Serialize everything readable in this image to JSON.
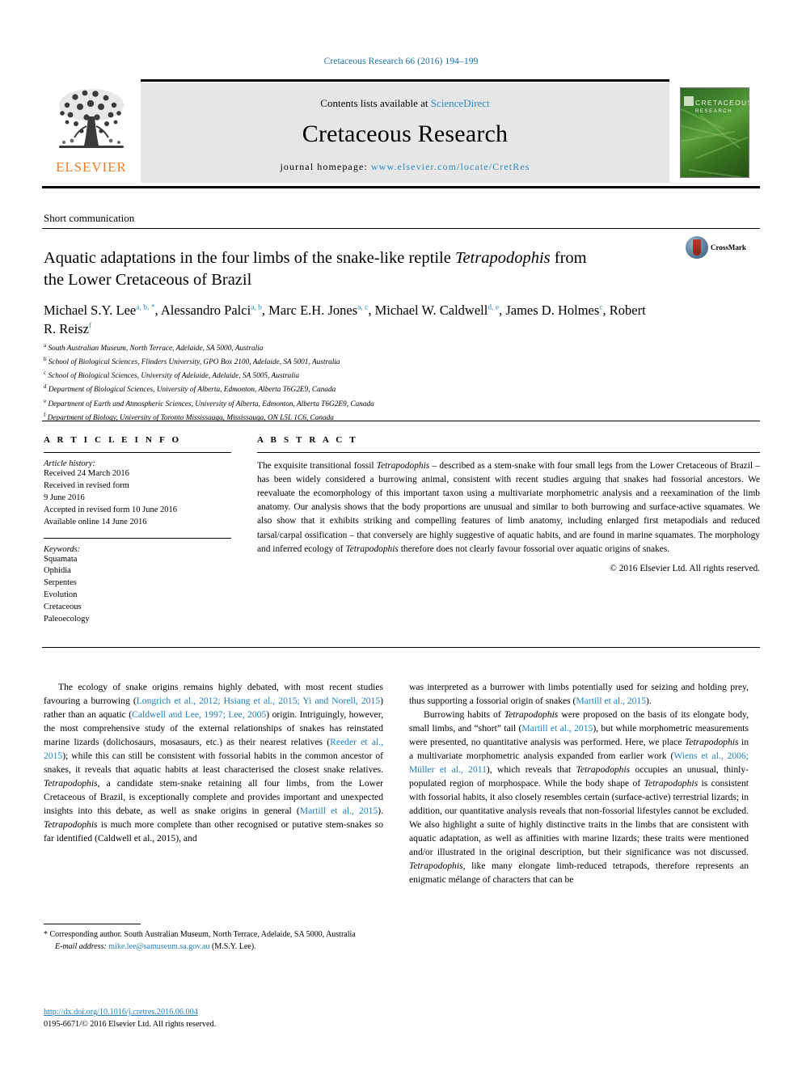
{
  "running_head": "Cretaceous Research 66 (2016) 194–199",
  "masthead": {
    "publisher_name": "ELSEVIER",
    "contents_prefix": "Contents lists available at ",
    "contents_link": "ScienceDirect",
    "journal_name": "Cretaceous Research",
    "homepage_prefix": "journal homepage: ",
    "homepage_url": "www.elsevier.com/locate/CretRes",
    "cover_title": "CRETACEOUS",
    "cover_subtitle": "RESEARCH"
  },
  "article": {
    "section_type": "Short communication",
    "title_line1": "Aquatic adaptations in the four limbs of the snake-like reptile",
    "title_italic": "Tetrapodophis",
    "title_line2_rest": " from the Lower Cretaceous of Brazil",
    "crossmark_label": "CrossMark",
    "authors": [
      {
        "name": "Michael S.Y. Lee",
        "sup": "a, b, *"
      },
      {
        "name": "Alessandro Palci",
        "sup": "a, b"
      },
      {
        "name": "Marc E.H. Jones",
        "sup": "a, c"
      },
      {
        "name": "Michael W. Caldwell",
        "sup": "d, e"
      },
      {
        "name": "James D. Holmes",
        "sup": "c"
      },
      {
        "name": "Robert R. Reisz",
        "sup": "f"
      }
    ],
    "affiliations": [
      {
        "marker": "a",
        "text": "South Australian Museum, North Terrace, Adelaide, SA 5000, Australia"
      },
      {
        "marker": "b",
        "text": "School of Biological Sciences, Flinders University, GPO Box 2100, Adelaide, SA 5001, Australia"
      },
      {
        "marker": "c",
        "text": "School of Biological Sciences, University of Adelaide, Adelaide, SA 5005, Australia"
      },
      {
        "marker": "d",
        "text": "Department of Biological Sciences, University of Alberta, Edmonton, Alberta T6G2E9, Canada"
      },
      {
        "marker": "e",
        "text": "Department of Earth and Atmospheric Sciences, University of Alberta, Edmonton, Alberta T6G2E9, Canada"
      },
      {
        "marker": "f",
        "text": "Department of Biology, University of Toronto Mississauga, Mississauga, ON L5L 1C6, Canada"
      }
    ]
  },
  "article_info": {
    "heading": "A R T I C L E    I N F O",
    "history_label": "Article history:",
    "history": [
      "Received 24 March 2016",
      "Received in revised form",
      "9 June 2016",
      "Accepted in revised form 10 June 2016",
      "Available online 14 June 2016"
    ],
    "keywords_label": "Keywords:",
    "keywords": [
      "Squamata",
      "Ophidia",
      "Serpentes",
      "Evolution",
      "Cretaceous",
      "Paleoecology"
    ]
  },
  "abstract": {
    "heading": "A B S T R A C T",
    "part1": "The exquisite transitional fossil ",
    "taxon1": "Tetrapodophis",
    "part2": " – described as a stem-snake with four small legs from the Lower Cretaceous of Brazil – has been widely considered a burrowing animal, consistent with recent studies arguing that snakes had fossorial ancestors. We reevaluate the ecomorphology of this important taxon using a multivariate morphometric analysis and a reexamination of the limb anatomy. Our analysis shows that the body proportions are unusual and similar to both burrowing and surface-active squamates. We also show that it exhibits striking and compelling features of limb anatomy, including enlarged first metapodials and reduced tarsal/carpal ossification – that conversely are highly suggestive of aquatic habits, and are found in marine squamates. The morphology and inferred ecology of ",
    "taxon2": "Tetrapodophis",
    "part3": " therefore does not clearly favour fossorial over aquatic origins of snakes.",
    "copyright": "© 2016 Elsevier Ltd. All rights reserved."
  },
  "body": {
    "left_paragraph": {
      "s1": "The ecology of snake origins remains highly debated, with most recent studies favouring a burrowing (",
      "c1": "Longrich et al., 2012; Hsiang et al., 2015; Yi and Norell, 2015",
      "s2": ") rather than an aquatic (",
      "c2": "Caldwell and Lee, 1997; Lee, 2005",
      "s3": ") origin. Intriguingly, however, the most comprehensive study of the external relationships of snakes has reinstated marine lizards (dolichosaurs, mosasaurs, etc.) as their nearest relatives (",
      "c3": "Reeder et al., 2015",
      "s4": "); while this can still be consistent with fossorial habits in the common ancestor of snakes, it reveals that aquatic habits at least characterised the closest snake relatives. ",
      "t1": "Tetrapodophis",
      "s5": ", a candidate stem-snake retaining all four limbs, from the Lower Cretaceous of Brazil, is exceptionally complete and provides important and unexpected insights into this debate, as well as snake origins in general (",
      "c4": "Martill et al., 2015",
      "s6": "). ",
      "t2": "Tetrapodophis",
      "s7": " is much more complete than other recognised or putative stem-snakes so far identified (Caldwell et al., 2015), and"
    },
    "right_paragraph_1": {
      "s1": "was interpreted as a burrower with limbs potentially used for seizing and holding prey, thus supporting a fossorial origin of snakes (",
      "c1": "Martill et al., 2015",
      "s2": ")."
    },
    "right_paragraph_2": {
      "s1": "Burrowing habits of ",
      "t1": "Tetrapodophis",
      "s2": " were proposed on the basis of its elongate body, small limbs, and “short” tail (",
      "c1": "Martill et al., 2015",
      "s3": "), but while morphometric measurements were presented, no quantitative analysis was performed. Here, we place ",
      "t2": "Tetrapodophis",
      "s4": " in a multivariate morphometric analysis expanded from earlier work (",
      "c2": "Wiens et al., 2006; Müller et al., 2011",
      "s5": "), which reveals that ",
      "t3": "Tetrapodophis",
      "s6": " occupies an unusual, thinly-populated region of morphospace. While the body shape of ",
      "t4": "Tetrapodophis",
      "s7": " is consistent with fossorial habits, it also closely resembles certain (surface-active) terrestrial lizards; in addition, our quantitative analysis reveals that non-fossorial lifestyles cannot be excluded. We also highlight a suite of highly distinctive traits in the limbs that are consistent with aquatic adaptation, as well as affinities with marine lizards; these traits were mentioned and/or illustrated in the original description, but their significance was not discussed. ",
      "t5": "Tetrapodophis",
      "s8": ", like many elongate limb-reduced tetrapods, therefore represents an enigmatic mélange of characters that can be"
    }
  },
  "footnotes": {
    "corresponding": "* Corresponding author. South Australian Museum, North Terrace, Adelaide, SA 5000, Australia",
    "email_label": "E-mail address:",
    "email": "mike.lee@samuseum.sa.gov.au",
    "email_suffix": " (M.S.Y. Lee).",
    "doi": "http://dx.doi.org/10.1016/j.cretres.2016.06.004",
    "issn_line": "0195-6671/© 2016 Elsevier Ltd. All rights reserved."
  },
  "colors": {
    "link_blue": "#1f7fbf",
    "header_blue": "#1a6fa8",
    "elsevier_orange": "#f47b20",
    "banner_gray": "#e6e6e6"
  }
}
